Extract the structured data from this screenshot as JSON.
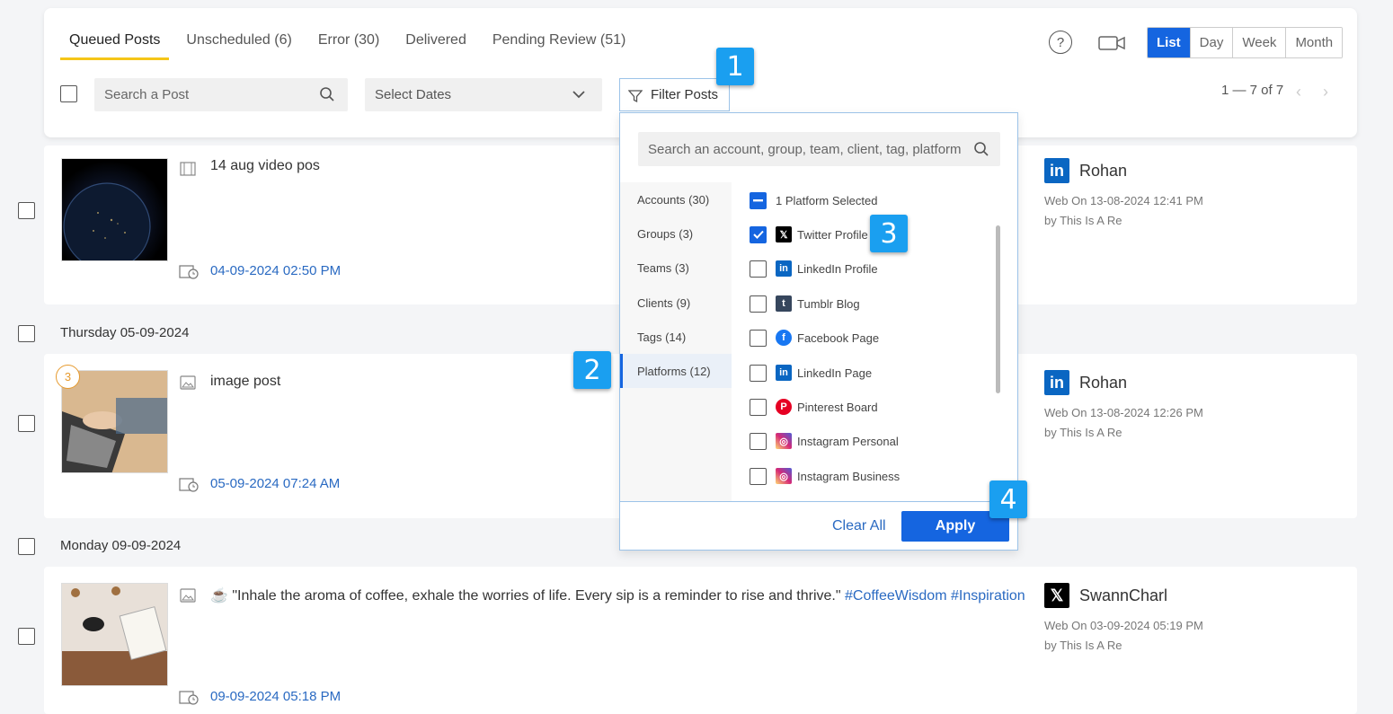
{
  "tabs": [
    {
      "label": "Queued Posts",
      "active": true
    },
    {
      "label": "Unscheduled (6)",
      "active": false
    },
    {
      "label": "Error (30)",
      "active": false
    },
    {
      "label": "Delivered",
      "active": false
    },
    {
      "label": "Pending Review (51)",
      "active": false
    }
  ],
  "view_modes": [
    "List",
    "Day",
    "Week",
    "Month"
  ],
  "active_view": "List",
  "search_placeholder": "Search a Post",
  "dates_placeholder": "Select Dates",
  "filter_label": "Filter Posts",
  "pager": {
    "text": "1 — 7 of 7"
  },
  "posts": [
    {
      "title": "14 aug video pos",
      "date": "04-09-2024 02:50 PM",
      "account_icon": "linkedin-icon",
      "account_name": "Rohan",
      "meta1": "Web On 13-08-2024 12:41 PM",
      "meta2": "by This Is A Re"
    },
    {
      "day": "Thursday 05-09-2024",
      "badge": "3",
      "title": "image post",
      "date": "05-09-2024 07:24 AM",
      "account_icon": "linkedin-icon",
      "account_name": "Rohan",
      "meta1": "Web On 13-08-2024 12:26 PM",
      "meta2": "by This Is A Re"
    },
    {
      "day": "Monday 09-09-2024",
      "title": "\"Inhale the aroma of coffee, exhale the worries of life. Every sip is a reminder to rise and thrive.\"",
      "hashtags": "#CoffeeWisdom #Inspiration",
      "date": "09-09-2024 05:18 PM",
      "account_icon": "x-icon",
      "account_name": "SwannCharl",
      "meta1": "Web On 03-09-2024 05:19 PM",
      "meta2": "by This Is A Re"
    }
  ],
  "filter_dropdown": {
    "search_placeholder": "Search an account, group, team, client, tag, platform",
    "categories": [
      {
        "label": "Accounts (30)"
      },
      {
        "label": "Groups (3)"
      },
      {
        "label": "Teams (3)"
      },
      {
        "label": "Clients (9)"
      },
      {
        "label": "Tags (14)"
      },
      {
        "label": "Platforms (12)",
        "active": true
      }
    ],
    "options": [
      {
        "label": "1 Platform Selected",
        "state": "partial"
      },
      {
        "label": "Twitter Profile",
        "state": "checked",
        "icon": "x-icon"
      },
      {
        "label": "LinkedIn Profile",
        "state": "unchecked",
        "icon": "linkedin-icon"
      },
      {
        "label": "Tumblr Blog",
        "state": "unchecked",
        "icon": "tumblr-icon"
      },
      {
        "label": "Facebook Page",
        "state": "unchecked",
        "icon": "facebook-icon"
      },
      {
        "label": "LinkedIn Page",
        "state": "unchecked",
        "icon": "linkedin-icon"
      },
      {
        "label": "Pinterest Board",
        "state": "unchecked",
        "icon": "pinterest-icon"
      },
      {
        "label": "Instagram Personal",
        "state": "unchecked",
        "icon": "instagram-icon"
      },
      {
        "label": "Instagram Business",
        "state": "unchecked",
        "icon": "instagram-icon"
      }
    ],
    "clear_label": "Clear All",
    "apply_label": "Apply"
  },
  "step_markers": [
    "1",
    "2",
    "3",
    "4"
  ],
  "colors": {
    "accent": "#1565e0",
    "tab_underline": "#f5c518",
    "link": "#2a6ac2",
    "step_marker": "#1a9ff0",
    "linkedin": "#0a66c2",
    "x": "#000000",
    "facebook": "#1877f2",
    "pinterest": "#e60023",
    "instagram": "#d62976",
    "tumblr": "#36465d"
  }
}
